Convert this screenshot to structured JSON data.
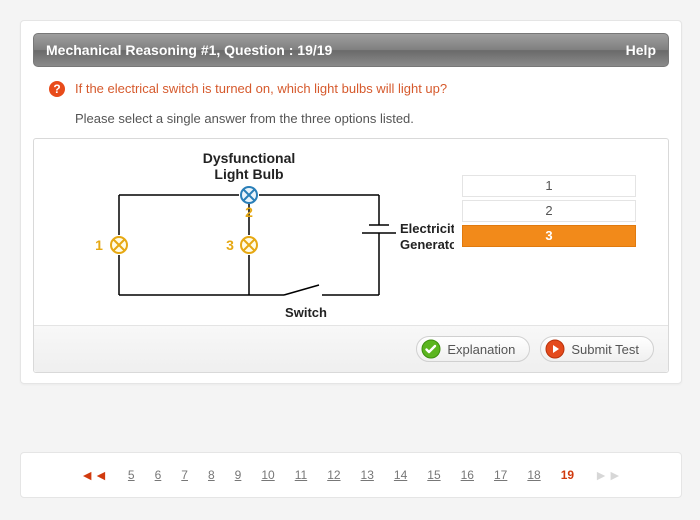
{
  "header": {
    "title": "Mechanical Reasoning #1, Question : 19/19",
    "help": "Help"
  },
  "question": {
    "prompt": "If the electrical switch is turned on, which light bulbs will light up?",
    "instruction": "Please select a single answer from the three options listed."
  },
  "diagram": {
    "dysfunctional_label_l1": "Dysfunctional",
    "dysfunctional_label_l2": "Light Bulb",
    "bulb1_label": "1",
    "bulb2_label": "2",
    "bulb3_label": "3",
    "generator_l1": "Electricity",
    "generator_l2": "Generator",
    "switch_label": "Switch"
  },
  "options": [
    "1",
    "2",
    "3"
  ],
  "selected_index": 2,
  "buttons": {
    "explanation": "Explanation",
    "submit": "Submit Test"
  },
  "pager": {
    "pages": [
      "5",
      "6",
      "7",
      "8",
      "9",
      "10",
      "11",
      "12",
      "13",
      "14",
      "15",
      "16",
      "17",
      "18"
    ],
    "current": "19"
  }
}
